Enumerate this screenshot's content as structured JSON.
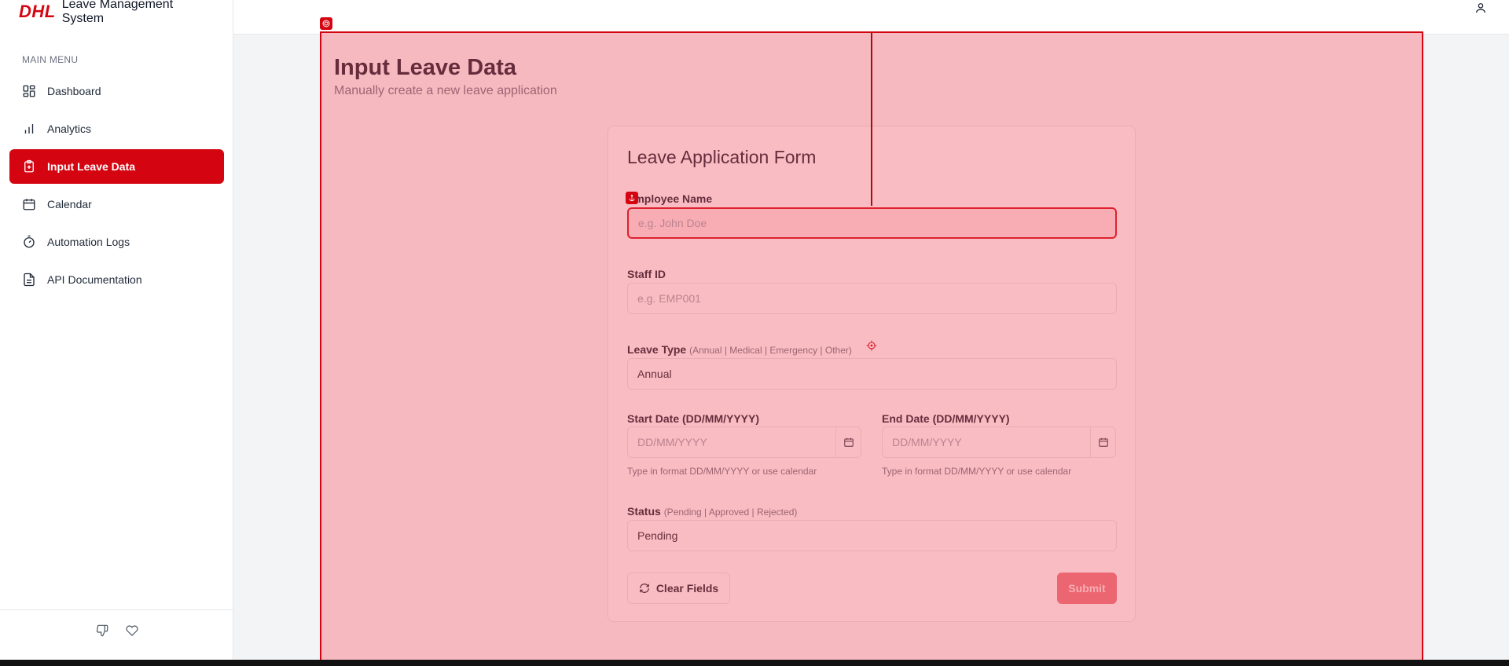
{
  "brand": {
    "logo": "DHL",
    "title": "Leave Management System"
  },
  "sidebar": {
    "menu_heading": "MAIN MENU",
    "items": [
      {
        "label": "Dashboard",
        "icon": "dashboard-icon"
      },
      {
        "label": "Analytics",
        "icon": "bar-chart-icon"
      },
      {
        "label": "Input Leave Data",
        "icon": "clipboard-plus-icon",
        "active": true
      },
      {
        "label": "Calendar",
        "icon": "calendar-icon"
      },
      {
        "label": "Automation Logs",
        "icon": "timer-icon"
      },
      {
        "label": "API Documentation",
        "icon": "file-text-icon"
      }
    ],
    "footer_icons": [
      "thumbs-down-icon",
      "heart-icon"
    ]
  },
  "header": {
    "user_icon": "user-icon"
  },
  "page": {
    "title": "Input Leave Data",
    "subtitle": "Manually create a new leave application"
  },
  "form": {
    "title": "Leave Application Form",
    "employee_name": {
      "label": "Employee Name",
      "placeholder": "e.g. John Doe",
      "value": ""
    },
    "staff_id": {
      "label": "Staff ID",
      "placeholder": "e.g. EMP001",
      "value": ""
    },
    "leave_type": {
      "label": "Leave Type",
      "hint": "(Annual | Medical | Emergency | Other)",
      "value": "Annual"
    },
    "start_date": {
      "label": "Start Date (DD/MM/YYYY)",
      "placeholder": "DD/MM/YYYY",
      "helper": "Type in format DD/MM/YYYY or use calendar"
    },
    "end_date": {
      "label": "End Date (DD/MM/YYYY)",
      "placeholder": "DD/MM/YYYY",
      "helper": "Type in format DD/MM/YYYY or use calendar"
    },
    "status": {
      "label": "Status",
      "hint": "(Pending | Approved | Rejected)",
      "value": "Pending"
    },
    "clear_label": "Clear Fields",
    "submit_label": "Submit"
  },
  "colors": {
    "brand_red": "#d40511",
    "overlay": "#f0505f",
    "submit_disabled": "#e8747b"
  }
}
